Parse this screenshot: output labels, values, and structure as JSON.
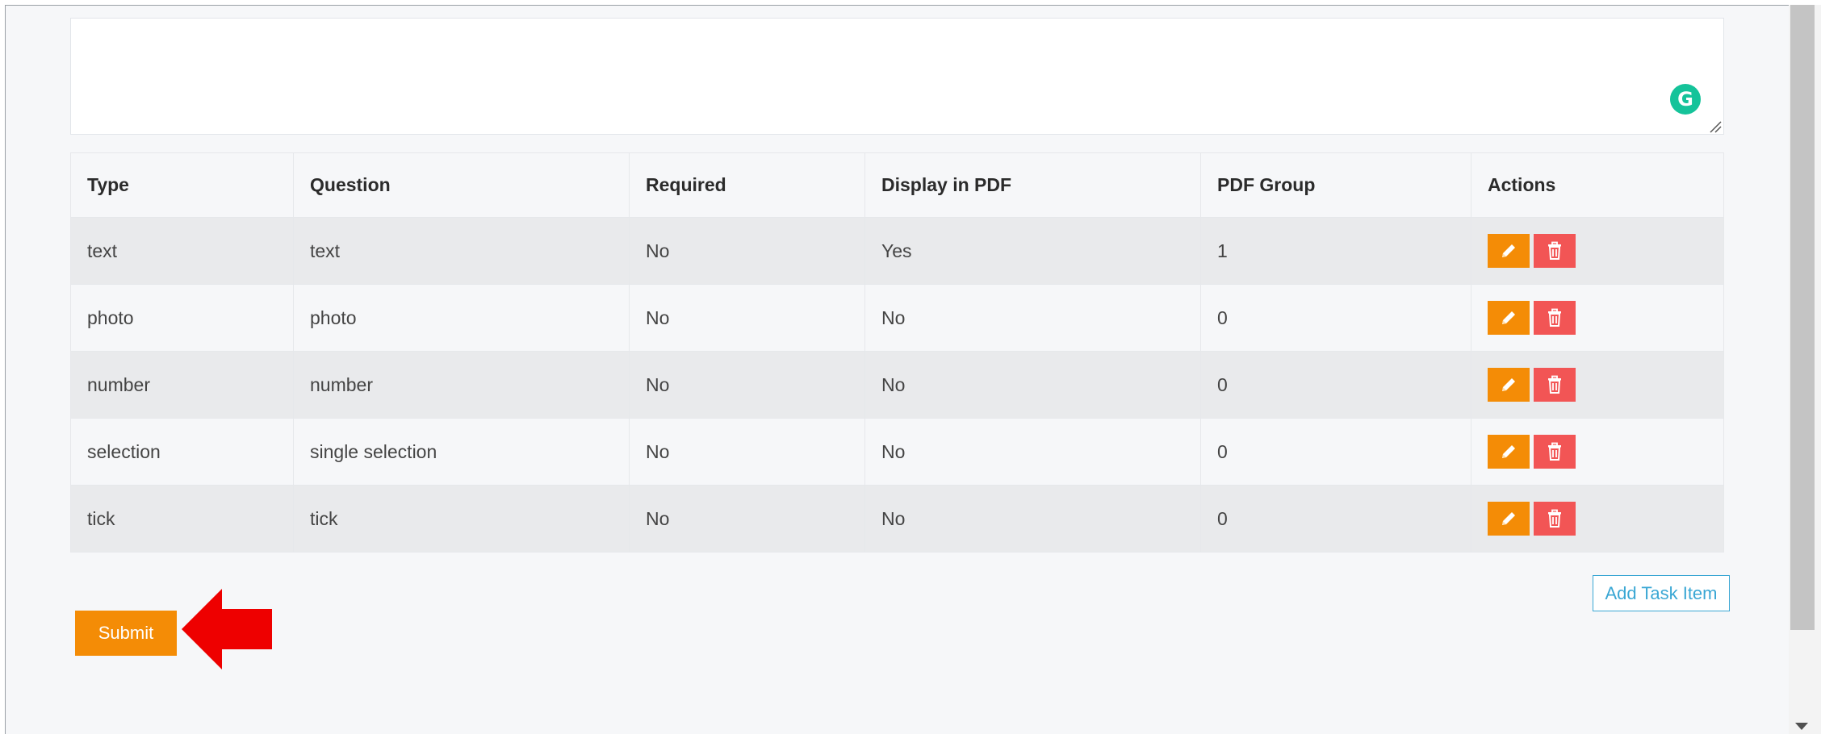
{
  "editor": {
    "value": "",
    "grammarly_letter": "G"
  },
  "table": {
    "headers": [
      "Type",
      "Question",
      "Required",
      "Display in PDF",
      "PDF Group",
      "Actions"
    ],
    "rows": [
      {
        "type": "text",
        "question": "text",
        "required": "No",
        "display_in_pdf": "Yes",
        "pdf_group": "1"
      },
      {
        "type": "photo",
        "question": "photo",
        "required": "No",
        "display_in_pdf": "No",
        "pdf_group": "0"
      },
      {
        "type": "number",
        "question": "number",
        "required": "No",
        "display_in_pdf": "No",
        "pdf_group": "0"
      },
      {
        "type": "selection",
        "question": "single selection",
        "required": "No",
        "display_in_pdf": "No",
        "pdf_group": "0"
      },
      {
        "type": "tick",
        "question": "tick",
        "required": "No",
        "display_in_pdf": "No",
        "pdf_group": "0"
      }
    ],
    "actions": {
      "edit_icon": "pencil-icon",
      "delete_icon": "trash-icon"
    }
  },
  "buttons": {
    "add_task_item": "Add Task Item",
    "submit": "Submit"
  },
  "colors": {
    "edit": "#f48c06",
    "delete": "#f25555",
    "submit": "#f48c06",
    "add_outline": "#3aa7d4",
    "annotation_arrow": "#ee0000"
  }
}
